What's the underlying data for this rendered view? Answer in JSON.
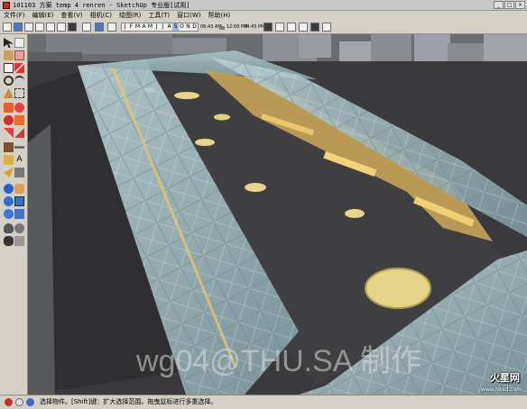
{
  "window": {
    "title": "101103 方案 temp 4 renren - SketchUp 专业版[试用]"
  },
  "menu": {
    "items": [
      "文件(F)",
      "编辑(E)",
      "查看(V)",
      "相机(C)",
      "绘图(R)",
      "工具(T)",
      "窗口(W)",
      "帮助(H)"
    ]
  },
  "toolbar": {
    "months": [
      "J",
      "F",
      "M",
      "A",
      "M",
      "J",
      "J",
      "A",
      "S",
      "O",
      "N",
      "D"
    ],
    "active_month_index": 8,
    "time_left": "06:43 AM",
    "time_mid": "12:00 PM",
    "time_right": "04:45 PM"
  },
  "status": {
    "text": "选择物件。[Shift]键：扩大选择范围。拖曳鼠标进行多重选择。"
  },
  "overlay": {
    "watermark": "wg04@THU.SA 制作",
    "site_logo": "火星网",
    "site_url": "www.hxsd.com"
  },
  "colors": {
    "ground": "#3c3c3e",
    "roof_glass": "#9fb7bd",
    "warm_light": "#e8c66a",
    "sky": "#6d6f72"
  }
}
